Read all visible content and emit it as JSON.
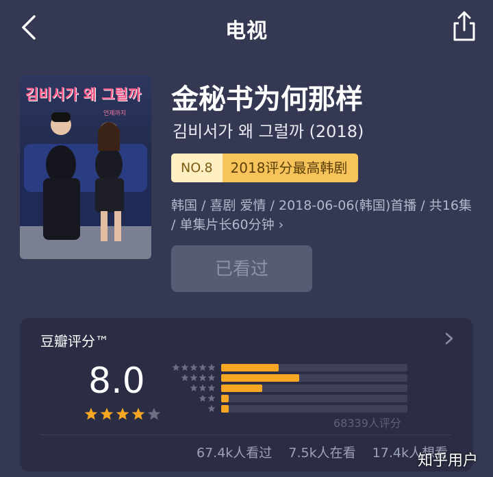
{
  "nav": {
    "title": "电视",
    "back_icon": "chevron-left-icon",
    "share_icon": "share-icon"
  },
  "poster": {
    "title_text": "김비서가 왜 그럴까"
  },
  "show": {
    "title_zh": "金秘书为何那样",
    "title_original": "김비서가 왜 그럴까 (2018)",
    "rank": "NO.8",
    "rank_label": "2018评分最高韩剧",
    "meta": "韩国 / 喜剧 爱情 / 2018-06-06(韩国)首播 / 共16集 / 单集片长60分钟",
    "meta_chevron": "›"
  },
  "actions": {
    "watched_label": "已看过"
  },
  "rating": {
    "header": "豆瓣评分™",
    "score": "8.0",
    "stars": 4,
    "max_stars": 5,
    "distribution": [
      {
        "stars": 5,
        "fraction": 0.31
      },
      {
        "stars": 4,
        "fraction": 0.42
      },
      {
        "stars": 3,
        "fraction": 0.22
      },
      {
        "stars": 2,
        "fraction": 0.04
      },
      {
        "stars": 1,
        "fraction": 0.04
      }
    ],
    "count_text": "68339人评分",
    "stats": {
      "watched": "67.4k人看过",
      "watching": "7.5k人在看",
      "wish": "17.4k人想看"
    }
  },
  "colors": {
    "background": "#343852",
    "card": "#2a2d43",
    "star_active": "#f5a623",
    "star_inactive": "#6c6f82",
    "badge_light": "#fff0c4",
    "badge_gold": "#f7c35b"
  },
  "watermark": "知乎用户"
}
